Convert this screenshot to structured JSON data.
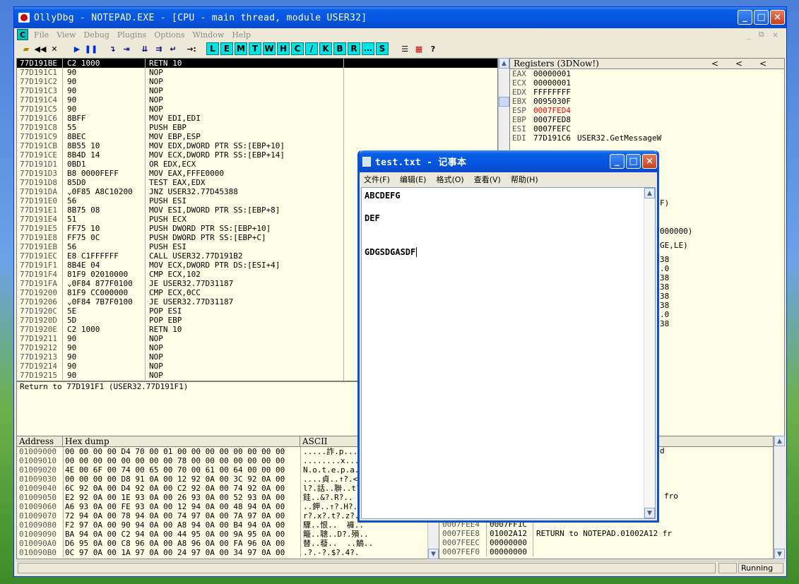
{
  "olly": {
    "title": "OllyDbg - NOTEPAD.EXE - [CPU - main thread, module USER32]",
    "logo": "C",
    "menu": [
      "File",
      "View",
      "Debug",
      "Plugins",
      "Options",
      "Window",
      "Help"
    ],
    "letter_buttons": [
      "L",
      "E",
      "M",
      "T",
      "W",
      "H",
      "C",
      "/",
      "K",
      "B",
      "R",
      "...",
      "S"
    ],
    "disasm": [
      [
        "77D191BE",
        "C2 1000",
        "RETN 10"
      ],
      [
        "77D191C1",
        "90",
        "NOP"
      ],
      [
        "77D191C2",
        "90",
        "NOP"
      ],
      [
        "77D191C3",
        "90",
        "NOP"
      ],
      [
        "77D191C4",
        "90",
        "NOP"
      ],
      [
        "77D191C5",
        "90",
        "NOP"
      ],
      [
        "77D191C6",
        "8BFF",
        "MOV EDI,EDI"
      ],
      [
        "77D191C8",
        "55",
        "PUSH EBP"
      ],
      [
        "77D191C9",
        "8BEC",
        "MOV EBP,ESP"
      ],
      [
        "77D191CB",
        "8B55 10",
        "MOV EDX,DWORD PTR SS:[EBP+10]"
      ],
      [
        "77D191CE",
        "8B4D 14",
        "MOV ECX,DWORD PTR SS:[EBP+14]"
      ],
      [
        "77D191D1",
        "0BD1",
        "OR EDX,ECX"
      ],
      [
        "77D191D3",
        "B8 0000FEFF",
        "MOV EAX,FFFE0000"
      ],
      [
        "77D191D8",
        "85D0",
        "TEST EAX,EDX"
      ],
      [
        "77D191DA",
        "⌄0F85 A8C10200",
        "JNZ USER32.77D45388"
      ],
      [
        "77D191E0",
        "56",
        "PUSH ESI"
      ],
      [
        "77D191E1",
        "8B75 08",
        "MOV ESI,DWORD PTR SS:[EBP+8]"
      ],
      [
        "77D191E4",
        "51",
        "PUSH ECX"
      ],
      [
        "77D191E5",
        "FF75 10",
        "PUSH DWORD PTR SS:[EBP+10]"
      ],
      [
        "77D191E8",
        "FF75 0C",
        "PUSH DWORD PTR SS:[EBP+C]"
      ],
      [
        "77D191EB",
        "56",
        "PUSH ESI"
      ],
      [
        "77D191EC",
        "E8 C1FFFFFF",
        "CALL USER32.77D191B2"
      ],
      [
        "77D191F1",
        "8B4E 04",
        "MOV ECX,DWORD PTR DS:[ESI+4]"
      ],
      [
        "77D191F4",
        "81F9 02010000",
        "CMP ECX,102"
      ],
      [
        "77D191FA",
        "⌄0F84 877F0100",
        "JE USER32.77D31187"
      ],
      [
        "77D19200",
        "81F9 CC000000",
        "CMP ECX,0CC"
      ],
      [
        "77D19206",
        "⌄0F84 7B7F0100",
        "JE USER32.77D31187"
      ],
      [
        "77D1920C",
        "5E",
        "POP ESI"
      ],
      [
        "77D1920D",
        "5D",
        "POP EBP"
      ],
      [
        "77D1920E",
        "C2 1000",
        "RETN 10"
      ],
      [
        "77D19211",
        "90",
        "NOP"
      ],
      [
        "77D19212",
        "90",
        "NOP"
      ],
      [
        "77D19213",
        "90",
        "NOP"
      ],
      [
        "77D19214",
        "90",
        "NOP"
      ],
      [
        "77D19215",
        "90",
        "NOP"
      ]
    ],
    "info": "Return to 77D191F1 (USER32.77D191F1)",
    "registers": {
      "title": "Registers (3DNow!)",
      "arrows": [
        "<",
        "<",
        "<"
      ],
      "lines": [
        [
          "EAX",
          "00000001",
          ""
        ],
        [
          "ECX",
          "00000001",
          ""
        ],
        [
          "EDX",
          "FFFFFFFF",
          ""
        ],
        [
          "EBX",
          "0095030F",
          ""
        ],
        [
          "ESP",
          "0007FED4",
          "changed"
        ],
        [
          "EBP",
          "0007FED8",
          ""
        ],
        [
          "ESI",
          "0007FEFC",
          ""
        ],
        [
          "EDI",
          "77D191C6",
          "USER32.GetMessageW"
        ]
      ],
      "partials": [
        "F)",
        "000000)",
        "GE,LE)",
        "38",
        ".0",
        "38",
        "38",
        "38",
        "38",
        ".0",
        "38"
      ]
    },
    "dump": {
      "headers": [
        "Address",
        "Hex dump",
        "ASCII"
      ],
      "rows": [
        [
          "01009000",
          "00 00 00 00 D4 70 00 01 00 00 00 00 00 00 00 00",
          ".....詐.p......"
        ],
        [
          "01009010",
          "00 00 00 00 00 00 00 00 78 00 00 00 00 00 00 00",
          "........x......"
        ],
        [
          "01009020",
          "4E 00 6F 00 74 00 65 00 70 00 61 00 64 00 00 00",
          "N.o.t.e.p.a.d.."
        ],
        [
          "01009030",
          "00 00 00 00 D8 91 0A 00 12 92 0A 00 3C 92 0A 00",
          "....貞..↑?.<?.."
        ],
        [
          "01009040",
          "6C 92 0A 00 D4 92 0A 00 C2 92 0A 00 74 92 0A 00",
          "l?.話..聨..t?.."
        ],
        [
          "01009050",
          "E2 92 0A 00 1E 93 0A 00 26 93 0A 00 52 93 0A 00",
          "銈..&?.R?.."
        ],
        [
          "01009060",
          "A6 93 0A 00 FE 93 0A 00 12 94 0A 00 48 94 0A 00",
          "..鉀..↑?.H?.."
        ],
        [
          "01009070",
          "72 94 0A 00 78 94 0A 00 74 97 0A 00 7A 97 0A 00",
          "r?.x?.t?.z?.."
        ],
        [
          "01009080",
          "F2 97 0A 00 90 94 0A 00 A8 94 0A 00 B4 94 0A 00",
          "驟..恨..  褲.."
        ],
        [
          "01009090",
          "BA 94 0A 00 C2 94 0A 00 44 95 0A 00 9A 95 0A 00",
          "簸..聰..D?.殞.."
        ],
        [
          "010090A0",
          "D6 95 0A 00 C8 96 0A 00 A8 96 0A 00 FA 96 0A 00",
          "替..蕟..  ..鵤.."
        ],
        [
          "010090B0",
          "0C 97 0A 00 1A 97 0A 00 24 97 0A 00 34 97 0A 00",
          ".?.-?.$?.4?."
        ]
      ]
    },
    "stack": {
      "partial_top": [
        "d",
        "fro"
      ],
      "rows": [
        [
          "0007FEE4",
          "0007FF1C",
          ""
        ],
        [
          "0007FEE8",
          "01002A12",
          "RETURN to NOTEPAD.01002A12 fr"
        ],
        [
          "0007FEEC",
          "00000000",
          ""
        ],
        [
          "0007FEF0",
          "00000000",
          ""
        ]
      ]
    },
    "status": "Running"
  },
  "notepad": {
    "title": "test.txt - 记事本",
    "menu": [
      "文件(F)",
      "编辑(E)",
      "格式(O)",
      "查看(V)",
      "帮助(H)"
    ],
    "lines": [
      "ABCDEFG",
      "",
      "DEF",
      "",
      "",
      "GDGSDGASDF"
    ]
  },
  "colors": {
    "pane_bg": "#fefee6",
    "reg_changed": "#ff0000",
    "xp_title": "#0554e0",
    "letter_button": "#00e5e5"
  }
}
